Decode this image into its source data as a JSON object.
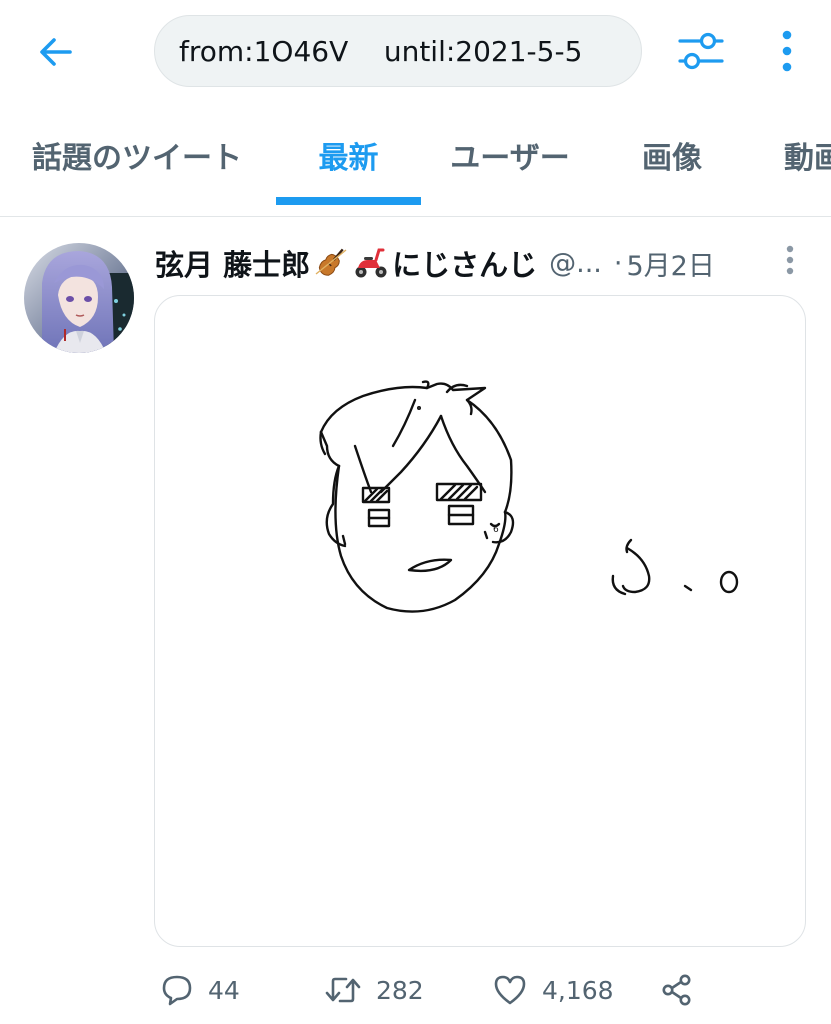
{
  "topbar": {
    "back_icon": "arrow-left-icon",
    "search_query": "from:1O46V    until:2021-5-5",
    "filter_icon": "sliders-icon",
    "more_icon": "vertical-dots-icon"
  },
  "tabs": [
    {
      "label": "話題のツイート",
      "active": false
    },
    {
      "label": "最新",
      "active": true
    },
    {
      "label": "ユーザー",
      "active": false
    },
    {
      "label": "画像",
      "active": false
    },
    {
      "label": "動画",
      "active": false
    }
  ],
  "tweet": {
    "display_name": "弦月 藤士郎",
    "emojis": [
      "violin-emoji",
      "scooter-emoji"
    ],
    "display_name_suffix": "にじさんじ",
    "handle": "@...",
    "separator": "·",
    "timestamp": "5月2日",
    "media": {
      "type": "drawing",
      "description_icon": "sketch-face-drawing"
    },
    "stats": {
      "replies": "44",
      "retweets": "282",
      "likes": "4,168"
    }
  },
  "colors": {
    "accent": "#1d9bf0",
    "secondary_text": "#536471",
    "primary_text": "#0f1419",
    "search_bg": "#eff3f4",
    "divider": "#e2e6e8"
  }
}
